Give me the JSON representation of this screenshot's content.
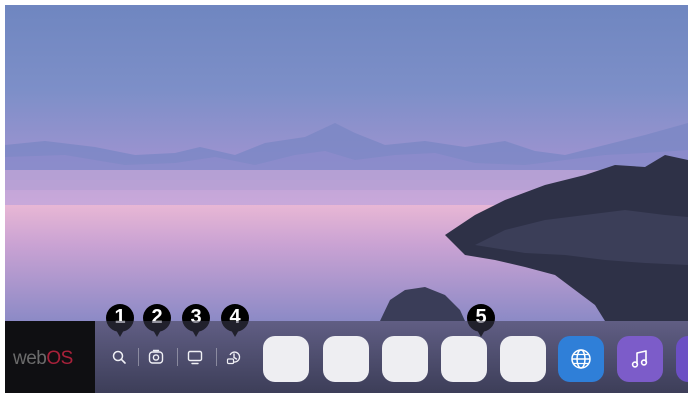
{
  "brand": {
    "logo_main": "web",
    "logo_accent": "OS"
  },
  "quick_buttons": [
    {
      "name": "search",
      "icon": "search-icon"
    },
    {
      "name": "camera",
      "icon": "camera-icon"
    },
    {
      "name": "input",
      "icon": "monitor-icon"
    },
    {
      "name": "settings",
      "icon": "settings-icon"
    }
  ],
  "callouts": [
    "1",
    "2",
    "3",
    "4",
    "5"
  ],
  "app_tiles": [
    "empty",
    "empty",
    "empty",
    "empty",
    "empty",
    "web-browser",
    "music"
  ],
  "colors": {
    "accent": "#a8213a",
    "browser": "#2f7fd8",
    "music": "#7c5cc9",
    "partial_app": "#6b4fc4"
  }
}
